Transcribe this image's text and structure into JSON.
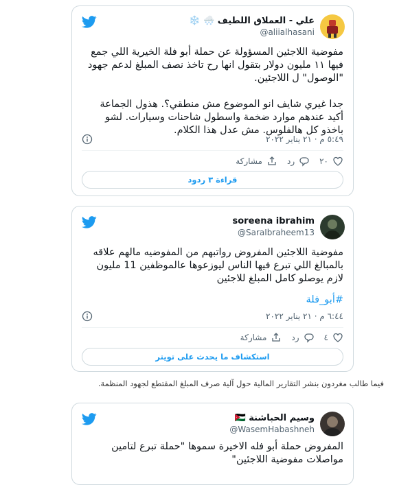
{
  "colors": {
    "twitter_blue": "#1d9bf0",
    "border": "#cfd9de",
    "muted": "#536471",
    "like_red": "#e0245e"
  },
  "tweet1": {
    "name": "علي - العملاق اللطيف 🌨️ ❄️",
    "handle": "@aliialhasani",
    "line1": "مفوضية اللاجئين المسؤولة عن حملة أبو فلة الخيرية اللي جمع",
    "line2": "فيها ١١ مليون دولار بتقول انها رح تاخذ نصف المبلغ لدعم جهود",
    "line3": "\"الوصول\" ل اللاجئين.",
    "line4": "جدا غيري شايف انو الموضوع مش منطقي؟. هذول الجماعة",
    "line5": "أكيد عندهم موارد ضخمة واسطول شاحنات وسيارات. لشو",
    "line6": "باخذو كل هالفلوس. مش عدل هذا الكلام.",
    "timestamp": "٥:٤٩ م · ٢١ يناير ٢٠٢٢",
    "likes": "٢٠",
    "reply_label": "رد",
    "share_label": "مشاركة",
    "read_replies": "قراءة ٣ ردود",
    "icons": [
      "twitter-bird-icon",
      "info-icon",
      "heart-icon",
      "reply-icon",
      "share-icon"
    ]
  },
  "tweet2": {
    "name": "soreena ibrahim",
    "handle": "@SaraIbraheem13",
    "line1": "مفوضية اللاجئين المفروض رواتبهم من المفوضيه مالهم علاقه",
    "line2": "بالمبالغ اللي تبرع فيها الناس ليوزعوها عالموظفين 11 مليون",
    "line3": "لازم يوصلو كامل المبلغ للاجئين",
    "hashtag": "#أبو_فلة",
    "timestamp": "٦:٤٤ م · ٢١ يناير ٢٠٢٢",
    "likes": "٤",
    "reply_label": "رد",
    "share_label": "مشاركة",
    "explore": "استكشاف ما يحدث على تويتر"
  },
  "caption": "فيما طالب مغردون بنشر التقارير المالية حول آلية صرف المبلغ المقتطع لجهود المنظمة.",
  "tweet3": {
    "name": "وسيم الحباشنة 🇯🇴",
    "handle": "@WasemHabashneh",
    "line1": "المفروض حملة أبو فله الاخيرة سموها \"حملة تبرع لتامين",
    "line2": "مواصلات مفوضية اللاجئين\""
  }
}
